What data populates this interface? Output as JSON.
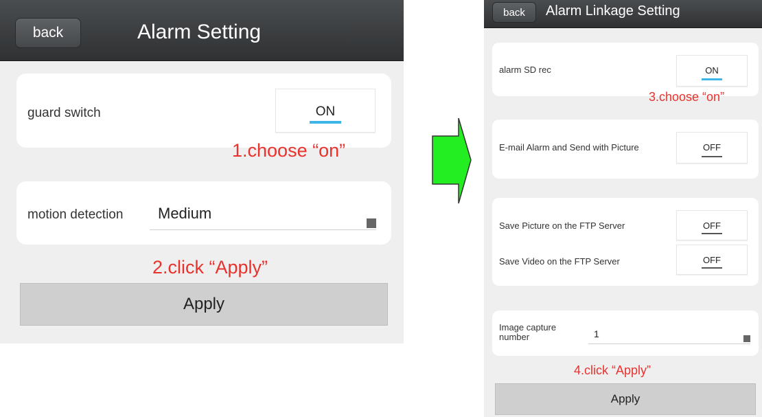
{
  "colors": {
    "annotation_red": "#e8322e",
    "toggle_on_accent": "#3db5e6",
    "toggle_off_accent": "#555555",
    "arrow_fill": "#22ee22"
  },
  "left_screen": {
    "header": {
      "back_label": "back",
      "title": "Alarm Setting"
    },
    "guard_switch": {
      "label": "guard switch",
      "toggle_value": "ON"
    },
    "annotation_1": "1.choose “on”",
    "motion_detection": {
      "label": "motion detection",
      "selected": "Medium"
    },
    "annotation_2": "2.click “Apply”",
    "apply_label": "Apply"
  },
  "arrow": {
    "icon": "arrow-right-icon"
  },
  "right_screen": {
    "header": {
      "back_label": "back",
      "title": "Alarm Linkage Setting"
    },
    "alarm_sd_rec": {
      "label": "alarm SD rec",
      "toggle_value": "ON"
    },
    "annotation_3": "3.choose “on”",
    "email_alarm": {
      "label": "E-mail Alarm and Send with Picture",
      "toggle_value": "OFF"
    },
    "ftp_picture": {
      "label": "Save Picture on the FTP Server",
      "toggle_value": "OFF"
    },
    "ftp_video": {
      "label": "Save Video on the FTP Server",
      "toggle_value": "OFF"
    },
    "image_capture": {
      "label_line1": "Image capture",
      "label_line2": "number",
      "selected": "1"
    },
    "annotation_4": "4.click “Apply”",
    "apply_label": "Apply"
  }
}
